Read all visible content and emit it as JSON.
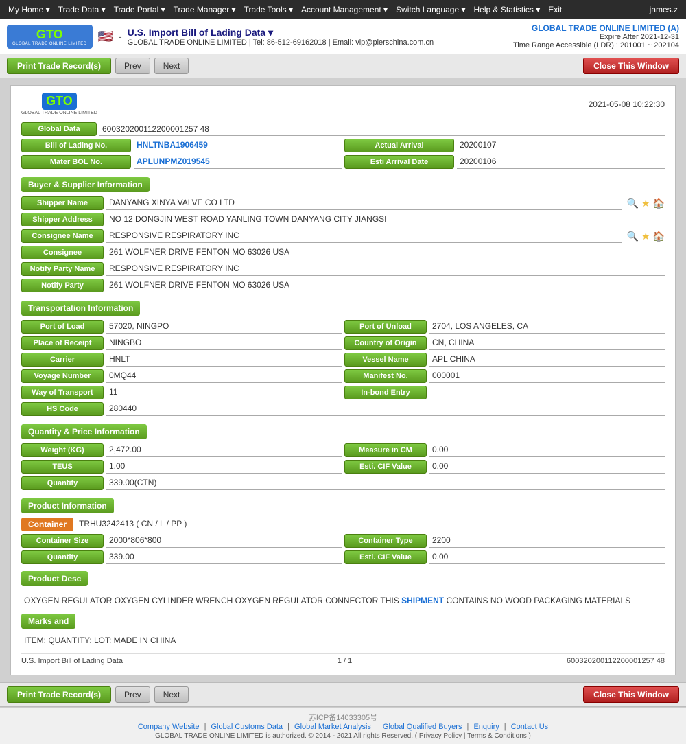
{
  "nav": {
    "items": [
      {
        "label": "My Home ▾",
        "id": "my-home"
      },
      {
        "label": "Trade Data ▾",
        "id": "trade-data"
      },
      {
        "label": "Trade Portal ▾",
        "id": "trade-portal"
      },
      {
        "label": "Trade Manager ▾",
        "id": "trade-manager"
      },
      {
        "label": "Trade Tools ▾",
        "id": "trade-tools"
      },
      {
        "label": "Account Management ▾",
        "id": "account-management"
      },
      {
        "label": "Switch Language ▾",
        "id": "switch-language"
      },
      {
        "label": "Help & Statistics ▾",
        "id": "help-statistics"
      },
      {
        "label": "Exit",
        "id": "exit"
      }
    ],
    "user": "james.z"
  },
  "header": {
    "title": "U.S. Import Bill of Lading Data ▾",
    "sub_info": "GLOBAL TRADE ONLINE LIMITED | Tel: 86-512-69162018 | Email: vip@pierschina.com.cn",
    "company": "GLOBAL TRADE ONLINE LIMITED (A)",
    "expire": "Expire After 2021-12-31",
    "time_range": "Time Range Accessible (LDR) : 201001 ~ 202104"
  },
  "toolbar": {
    "print_label": "Print Trade Record(s)",
    "prev_label": "Prev",
    "next_label": "Next",
    "close_label": "Close This Window"
  },
  "record": {
    "datetime": "2021-05-08 10:22:30",
    "logo_sub": "GLOBAL TRADE ONLINE LIMITED",
    "global_data_label": "Global Data",
    "global_data_value": "600320200112200001257 48",
    "bol_label": "Bill of Lading No.",
    "bol_value": "HNLTNBA1906459",
    "actual_arrival_label": "Actual Arrival",
    "actual_arrival_value": "20200107",
    "master_bol_label": "Mater BOL No.",
    "master_bol_value": "APLUNPMZ019545",
    "esti_arrival_label": "Esti Arrival Date",
    "esti_arrival_value": "20200106",
    "buyer_supplier_section": "Buyer & Supplier Information",
    "shipper_name_label": "Shipper Name",
    "shipper_name_value": "DANYANG XINYA VALVE CO LTD",
    "shipper_address_label": "Shipper Address",
    "shipper_address_value": "NO 12 DONGJIN WEST ROAD YANLING TOWN DANYANG CITY JIANGSI",
    "consignee_name_label": "Consignee Name",
    "consignee_name_value": "RESPONSIVE RESPIRATORY INC",
    "consignee_label": "Consignee",
    "consignee_value": "261 WOLFNER DRIVE FENTON MO 63026 USA",
    "notify_party_name_label": "Notify Party Name",
    "notify_party_name_value": "RESPONSIVE RESPIRATORY INC",
    "notify_party_label": "Notify Party",
    "notify_party_value": "261 WOLFNER DRIVE FENTON MO 63026 USA",
    "transportation_section": "Transportation Information",
    "port_of_load_label": "Port of Load",
    "port_of_load_value": "57020, NINGPO",
    "port_of_unload_label": "Port of Unload",
    "port_of_unload_value": "2704, LOS ANGELES, CA",
    "place_of_receipt_label": "Place of Receipt",
    "place_of_receipt_value": "NINGBO",
    "country_of_origin_label": "Country of Origin",
    "country_of_origin_value": "CN, CHINA",
    "carrier_label": "Carrier",
    "carrier_value": "HNLT",
    "vessel_name_label": "Vessel Name",
    "vessel_name_value": "APL CHINA",
    "voyage_number_label": "Voyage Number",
    "voyage_number_value": "0MQ44",
    "manifest_no_label": "Manifest No.",
    "manifest_no_value": "000001",
    "way_of_transport_label": "Way of Transport",
    "way_of_transport_value": "11",
    "in_bond_entry_label": "In-bond Entry",
    "in_bond_entry_value": "",
    "hs_code_label": "HS Code",
    "hs_code_value": "280440",
    "quantity_price_section": "Quantity & Price Information",
    "weight_label": "Weight (KG)",
    "weight_value": "2,472.00",
    "measure_in_cm_label": "Measure in CM",
    "measure_in_cm_value": "0.00",
    "teus_label": "TEUS",
    "teus_value": "1.00",
    "esti_cif_label": "Esti. CIF Value",
    "esti_cif_value": "0.00",
    "quantity_label": "Quantity",
    "quantity_value": "339.00(CTN)",
    "product_info_section": "Product Information",
    "container_label": "Container",
    "container_value": "TRHU3242413 ( CN / L / PP )",
    "container_size_label": "Container Size",
    "container_size_value": "2000*806*800",
    "container_type_label": "Container Type",
    "container_type_value": "2200",
    "quantity2_label": "Quantity",
    "quantity2_value": "339.00",
    "esti_cif2_label": "Esti. CIF Value",
    "esti_cif2_value": "0.00",
    "product_desc_label": "Product Desc",
    "product_desc_text": "OXYGEN REGULATOR OXYGEN CYLINDER WRENCH OXYGEN REGULATOR CONNECTOR THIS SHIPMENT CONTAINS NO WOOD PACKAGING MATERIALS",
    "product_desc_link": "SHIPMENT",
    "marks_label": "Marks and",
    "marks_value": "ITEM: QUANTITY: LOT: MADE IN CHINA",
    "footer_left": "U.S. Import Bill of Lading Data",
    "footer_center": "1 / 1",
    "footer_right": "600320200112200001257 48"
  },
  "footer": {
    "icp": "苏ICP备14033305号",
    "links": [
      {
        "label": "Company Website"
      },
      {
        "label": "Global Customs Data"
      },
      {
        "label": "Global Market Analysis"
      },
      {
        "label": "Global Qualified Buyers"
      },
      {
        "label": "Enquiry"
      },
      {
        "label": "Contact Us"
      }
    ],
    "copyright": "GLOBAL TRADE ONLINE LIMITED is authorized. © 2014 - 2021 All rights Reserved. ( Privacy Policy | Terms & Conditions )"
  }
}
